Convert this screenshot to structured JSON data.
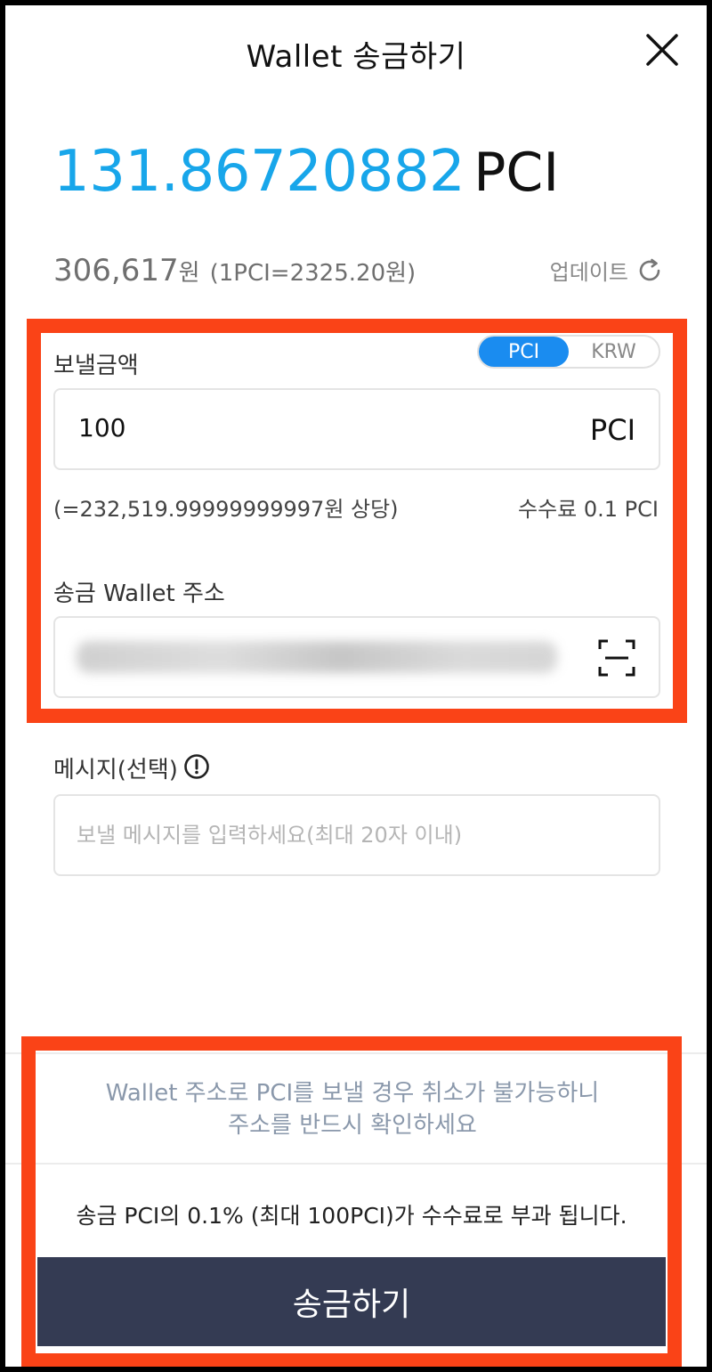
{
  "header": {
    "title": "Wallet 송금하기",
    "close_icon": "close-icon"
  },
  "balance": {
    "amount": "131.86720882",
    "unit": "PCI",
    "krw_value": "306,617",
    "krw_won": "원",
    "rate": "(1PCI=2325.20원)",
    "update_label": "업데이트",
    "update_icon": "refresh-icon"
  },
  "send_amount": {
    "label": "보낼금액",
    "toggle": {
      "options": [
        "PCI",
        "KRW"
      ],
      "selected": "PCI"
    },
    "value": "100",
    "unit": "PCI",
    "krw_equivalent": "(=232,519.99999999997원 상당)",
    "fee": "수수료 0.1 PCI"
  },
  "wallet_address": {
    "label": "송금 Wallet 주소",
    "scan_icon": "qr-scan-icon"
  },
  "message": {
    "label": "메시지(선택)",
    "info_icon": "info-icon",
    "placeholder": "보낼 메시지를 입력하세요(최대 20자 이내)"
  },
  "warning": {
    "line1": "Wallet 주소로 PCI를 보낼 경우 취소가 불가능하니",
    "line2": "주소를 반드시 확인하세요"
  },
  "fee_notice": "송금 PCI의 0.1% (최대 100PCI)가 수수료로 부과 됩니다.",
  "submit": {
    "label": "송금하기"
  },
  "colors": {
    "accent": "#18a6ea",
    "toggle_active": "#1a8cf0",
    "highlight": "#fa4317",
    "button_bg": "#343b53",
    "warning_text": "#8a98ab"
  }
}
